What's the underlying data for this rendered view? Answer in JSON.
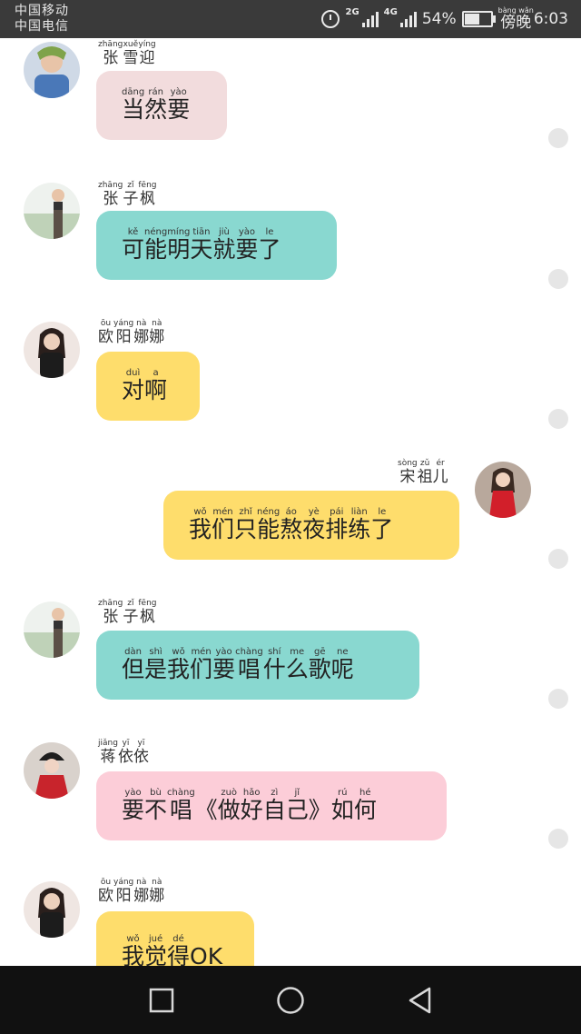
{
  "status_bar": {
    "carrier_1": "中国移动",
    "carrier_2": "中国电信",
    "net_1": "2G",
    "net_2": "4G",
    "battery": "54%",
    "period_pinyin": "bàng wǎn",
    "period": "傍晚",
    "time": "6:03"
  },
  "colors": {
    "pink_light": "#f2dcdd",
    "teal": "#89d8d0",
    "yellow": "#fedd6c",
    "pink": "#fccdd8",
    "status_bar": "#3a3a3a",
    "nav_bar": "#111111"
  },
  "messages": [
    {
      "name": [
        [
          "张",
          "zhāng"
        ],
        [
          "雪",
          "xuě"
        ],
        [
          "迎",
          "yíng"
        ]
      ],
      "text": [
        [
          "当",
          "dāng"
        ],
        [
          "然",
          "rán"
        ],
        [
          "要",
          "yào"
        ]
      ]
    },
    {
      "name": [
        [
          "张",
          "zhāng"
        ],
        [
          "子",
          "zǐ"
        ],
        [
          "枫",
          "fēng"
        ]
      ],
      "text": [
        [
          "可",
          "kě"
        ],
        [
          "能",
          "néng"
        ],
        [
          "明",
          "míng"
        ],
        [
          "天",
          "tiān"
        ],
        [
          "就",
          "jiù"
        ],
        [
          "要",
          "yào"
        ],
        [
          "了",
          "le"
        ]
      ]
    },
    {
      "name": [
        [
          "欧",
          "ōu"
        ],
        [
          "阳",
          "yáng"
        ],
        [
          "娜",
          "nà"
        ],
        [
          "娜",
          "nà"
        ]
      ],
      "text": [
        [
          "对",
          "duì"
        ],
        [
          "啊",
          "a"
        ]
      ]
    },
    {
      "name": [
        [
          "宋",
          "sòng"
        ],
        [
          "祖",
          "zǔ"
        ],
        [
          "儿",
          "ér"
        ]
      ],
      "text": [
        [
          "我",
          "wǒ"
        ],
        [
          "们",
          "mén"
        ],
        [
          "只",
          "zhǐ"
        ],
        [
          "能",
          "néng"
        ],
        [
          "熬",
          "áo"
        ],
        [
          "夜",
          "yè"
        ],
        [
          "排",
          "pái"
        ],
        [
          "练",
          "liàn"
        ],
        [
          "了",
          "le"
        ]
      ]
    },
    {
      "name": [
        [
          "张",
          "zhāng"
        ],
        [
          "子",
          "zǐ"
        ],
        [
          "枫",
          "fēng"
        ]
      ],
      "text": [
        [
          "但",
          "dàn"
        ],
        [
          "是",
          "shì"
        ],
        [
          "我",
          "wǒ"
        ],
        [
          "们",
          "mén"
        ],
        [
          "要",
          "yào"
        ],
        [
          "唱",
          "chàng"
        ],
        [
          "什",
          "shí"
        ],
        [
          "么",
          "me"
        ],
        [
          "歌",
          "gē"
        ],
        [
          "呢",
          "ne"
        ]
      ]
    },
    {
      "name": [
        [
          "蒋",
          "jiǎng"
        ],
        [
          "依",
          "yī"
        ],
        [
          "依",
          "yī"
        ]
      ],
      "text": [
        [
          "要",
          "yào"
        ],
        [
          "不",
          "bù"
        ],
        [
          "唱",
          "chàng"
        ],
        [
          "《",
          ""
        ],
        [
          "做",
          "zuò"
        ],
        [
          "好",
          "hǎo"
        ],
        [
          "自",
          "zì"
        ],
        [
          "己",
          "jǐ"
        ],
        [
          "》",
          ""
        ],
        [
          "如",
          "rú"
        ],
        [
          "何",
          "hé"
        ]
      ]
    },
    {
      "name": [
        [
          "欧",
          "ōu"
        ],
        [
          "阳",
          "yáng"
        ],
        [
          "娜",
          "nà"
        ],
        [
          "娜",
          "nà"
        ]
      ],
      "text": [
        [
          "我",
          "wǒ"
        ],
        [
          "觉",
          "jué"
        ],
        [
          "得",
          "dé"
        ],
        [
          "OK",
          ""
        ]
      ]
    }
  ]
}
